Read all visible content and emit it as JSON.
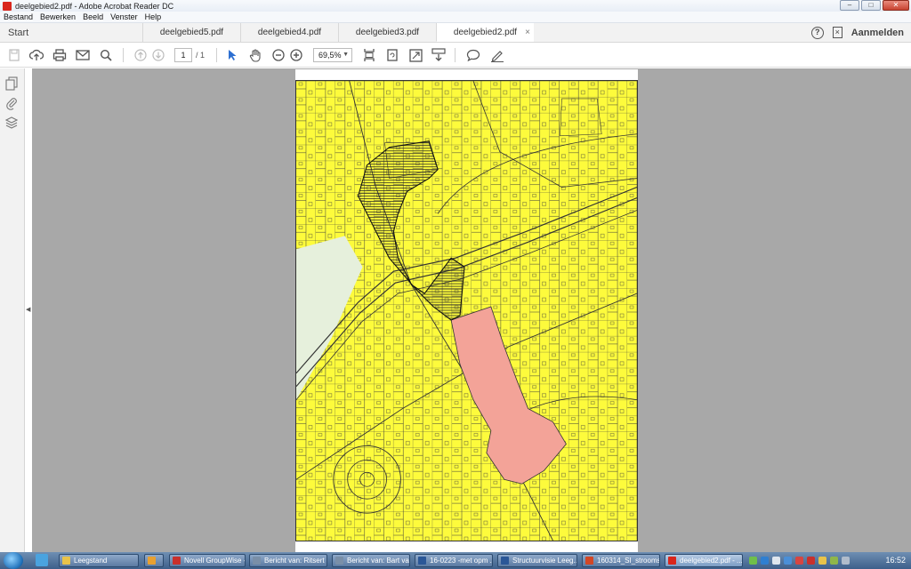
{
  "window": {
    "title": "deelgebied2.pdf - Adobe Acrobat Reader DC"
  },
  "menu": [
    "Bestand",
    "Bewerken",
    "Beeld",
    "Venster",
    "Help"
  ],
  "tabs": {
    "start": "Start",
    "documents": [
      {
        "label": "deelgebied5.pdf",
        "active": false
      },
      {
        "label": "deelgebied4.pdf",
        "active": false
      },
      {
        "label": "deelgebied3.pdf",
        "active": false
      },
      {
        "label": "deelgebied2.pdf",
        "active": true
      }
    ],
    "close_symbol": "×",
    "help_symbol": "?",
    "signin": "Aanmelden"
  },
  "toolbar": {
    "page_current": "1",
    "page_total": "/ 1",
    "zoom": "69,5%",
    "icons": [
      "save-icon",
      "upload-icon",
      "print-icon",
      "email-icon",
      "search-icon",
      "prev-page-icon",
      "next-page-icon",
      "select-arrow-icon",
      "hand-icon",
      "zoom-out-icon",
      "zoom-in-icon",
      "fit-page-icon",
      "rotate-icon",
      "full-screen-icon",
      "scroll-mode-icon",
      "comment-icon",
      "sign-icon"
    ]
  },
  "map": {
    "colors": {
      "base": "#fdfb3c",
      "highlight": "#f3a398",
      "green": "#e6f0dc",
      "lines": "#333333"
    }
  },
  "taskbar": {
    "items": [
      {
        "label": "Leegstand",
        "color": "#e8c34a",
        "active": false
      },
      {
        "label": "",
        "color": "#e8a030",
        "active": false
      },
      {
        "label": "Novell GroupWise -...",
        "color": "#c9302c",
        "active": false
      },
      {
        "label": "Bericht van: Ritsert ...",
        "color": "#7a8fa8",
        "active": false
      },
      {
        "label": "Bericht van: Bart va...",
        "color": "#7a8fa8",
        "active": false
      },
      {
        "label": "16-0223 -met opm ...",
        "color": "#2b5797",
        "active": false
      },
      {
        "label": "Structuurvisie Leeg...",
        "color": "#2b5797",
        "active": false
      },
      {
        "label": "160314_SI_strooms...",
        "color": "#d24726",
        "active": false
      },
      {
        "label": "deelgebied2.pdf - ...",
        "color": "#d9261c",
        "active": true
      }
    ],
    "clock": "16:52"
  }
}
